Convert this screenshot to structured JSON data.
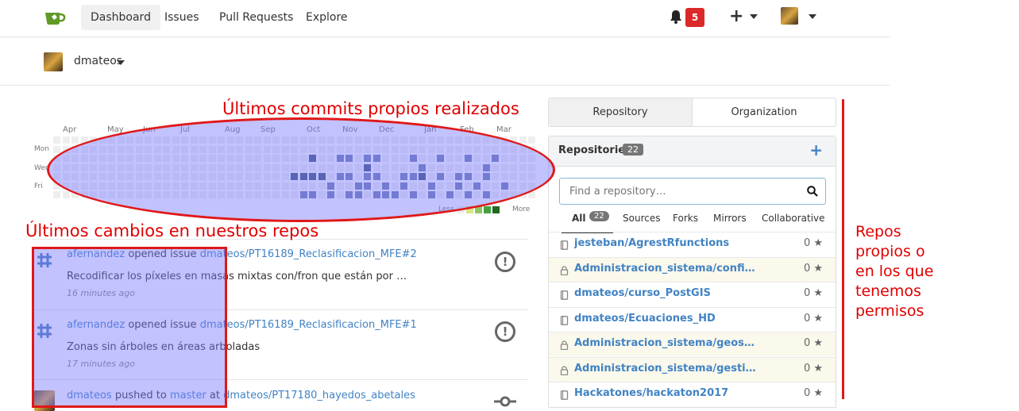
{
  "nav": {
    "items": [
      "Dashboard",
      "Issues",
      "Pull Requests",
      "Explore"
    ],
    "active": "Dashboard",
    "notifications": "5"
  },
  "user": {
    "name": "dmateos"
  },
  "heatmap": {
    "months": [
      "Apr",
      "May",
      "Jun",
      "Jul",
      "Aug",
      "Sep",
      "Oct",
      "Nov",
      "Dec",
      "Jan",
      "Feb",
      "Mar"
    ],
    "days": [
      "Mon",
      "Wed",
      "Fri"
    ],
    "legend_less": "Less",
    "legend_more": "More",
    "colors": [
      "#eeeeee",
      "#d6e685",
      "#8cc665",
      "#44a340",
      "#1e6823"
    ]
  },
  "feed": [
    {
      "user": "afernandez",
      "action": "opened issue",
      "target": "dmateos/PT16189_Reclasificacion_MFE#2",
      "body": "Recodificar los píxeles en masas mixtas con/fron que están por …",
      "time": "16 minutes ago"
    },
    {
      "user": "afernandez",
      "action": "opened issue",
      "target": "dmateos/PT16189_Reclasificacion_MFE#1",
      "body": "Zonas sin árboles en áreas arboladas",
      "time": "17 minutes ago"
    },
    {
      "user": "dmateos",
      "action": "pushed to",
      "branch": "master",
      "at": "at",
      "target": "dmateos/PT17180_hayedos_abetales"
    }
  ],
  "panel": {
    "tabs": [
      "Repository",
      "Organization"
    ],
    "title": "Repositories",
    "count": "22",
    "search_placeholder": "Find a repository…",
    "filters": [
      "All",
      "Sources",
      "Forks",
      "Mirrors",
      "Collaborative"
    ],
    "all_count": "22",
    "repos": [
      {
        "name": "jesteban/AgrestRfunctions",
        "stars": "0",
        "private": false
      },
      {
        "name": "Administracion_sistema/configuracion…",
        "stars": "0",
        "private": true
      },
      {
        "name": "dmateos/curso_PostGIS",
        "stars": "0",
        "private": false
      },
      {
        "name": "dmateos/Ecuaciones_HD",
        "stars": "0",
        "private": false
      },
      {
        "name": "Administracion_sistema/geoserver",
        "stars": "0",
        "private": true
      },
      {
        "name": "Administracion_sistema/gestion_servi…",
        "stars": "0",
        "private": true
      },
      {
        "name": "Hackatones/hackaton2017",
        "stars": "0",
        "private": false
      }
    ]
  },
  "annotations": {
    "commits": "Últimos commits propios realizados",
    "changes": "Últimos cambios en nuestros repos",
    "repos_l1": "Repos",
    "repos_l2": "propios o",
    "repos_l3": "en los que",
    "repos_l4": "tenemos",
    "repos_l5": "permisos"
  }
}
